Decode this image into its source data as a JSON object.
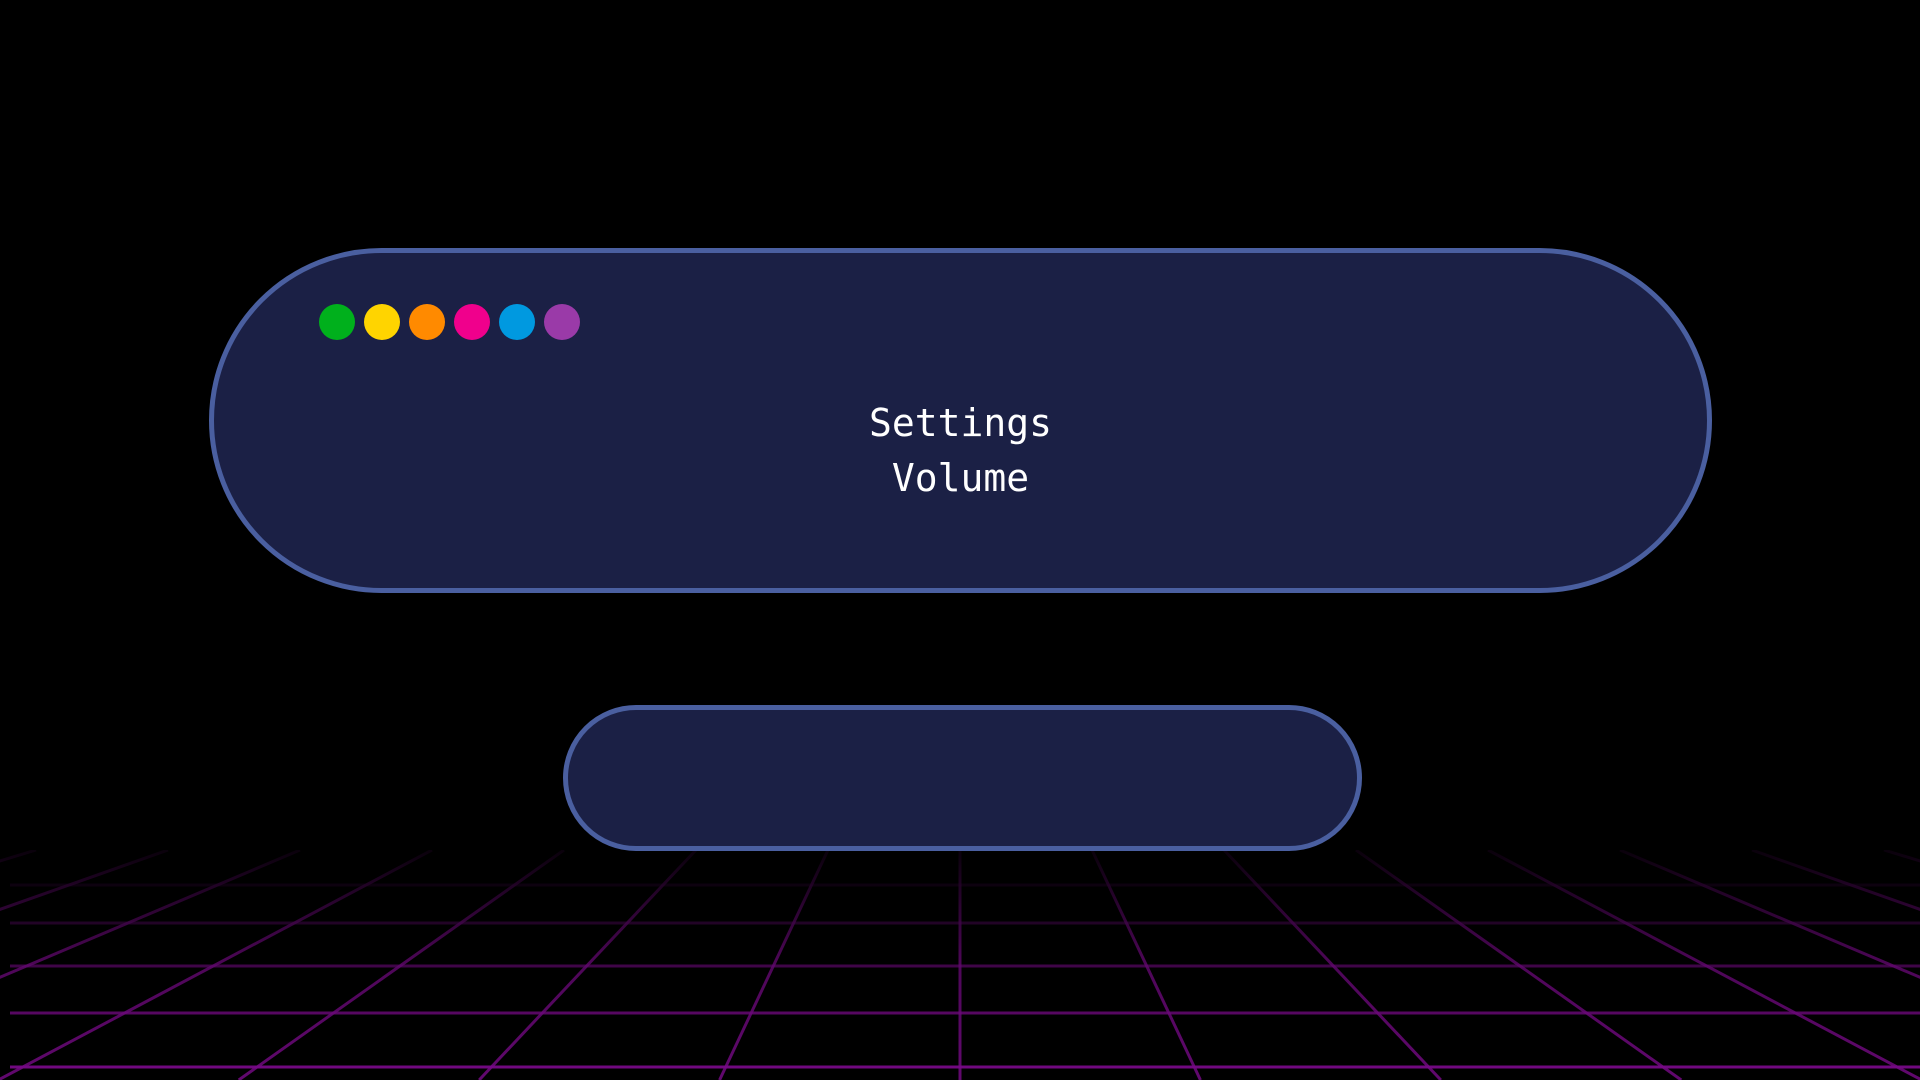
{
  "colors": {
    "background": "#000000",
    "panel_fill": "#1b2045",
    "panel_border": "#4a5fa0",
    "text": "#ffffff",
    "grid": "#7a0a8a"
  },
  "window_controls": [
    {
      "name": "green-dot",
      "color": "#00b01c"
    },
    {
      "name": "yellow-dot",
      "color": "#ffd400"
    },
    {
      "name": "orange-dot",
      "color": "#ff8a00"
    },
    {
      "name": "magenta-dot",
      "color": "#f0008c"
    },
    {
      "name": "blue-dot",
      "color": "#0099e0"
    },
    {
      "name": "purple-dot",
      "color": "#9a3aa8"
    }
  ],
  "main_panel": {
    "title": "Settings",
    "subtitle": "Volume"
  },
  "secondary_panel": {
    "label": ""
  }
}
